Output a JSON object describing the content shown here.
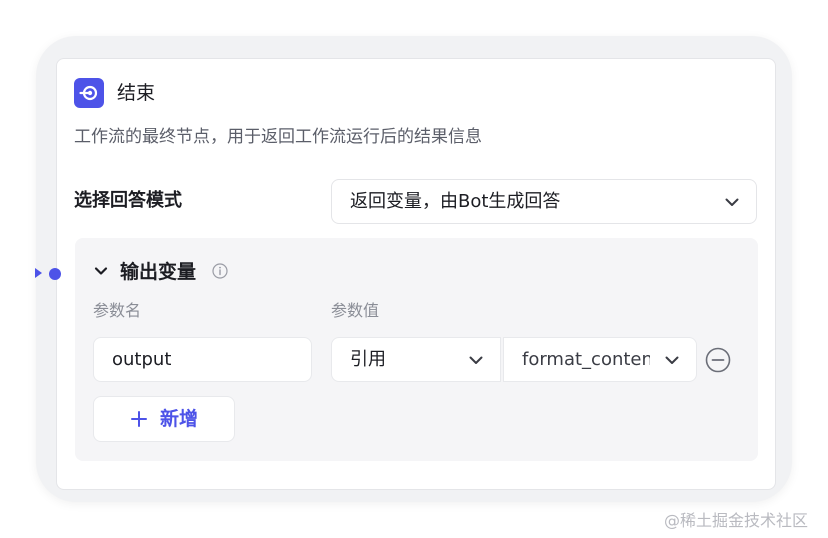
{
  "node": {
    "title": "结束",
    "icon": "end-node-icon",
    "description": "工作流的最终节点，用于返回工作流运行后的结果信息"
  },
  "answer_mode": {
    "label": "选择回答模式",
    "selected": "返回变量，由Bot生成回答"
  },
  "output": {
    "title": "输出变量",
    "expanded": true,
    "columns": {
      "name": "参数名",
      "value": "参数值"
    },
    "rows": [
      {
        "name": "output",
        "source": "引用",
        "variable": "format_content"
      }
    ],
    "add_label": "新增"
  },
  "watermark": "@稀土掘金技术社区",
  "colors": {
    "accent": "#4d53e8",
    "section_bg": "#f5f5f7",
    "muted_text": "#8a8d96"
  }
}
